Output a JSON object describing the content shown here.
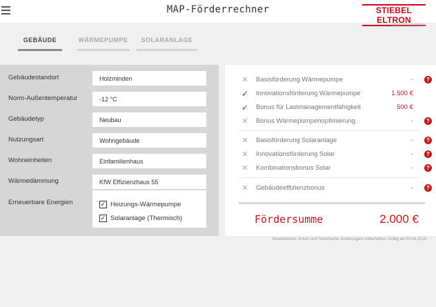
{
  "header": {
    "title": "MAP-Förderrechner",
    "logo_text": "STIEBEL ELTRON",
    "menu_icon": "hamburger-icon",
    "brand_color": "#d0021b"
  },
  "version": "IMT/ITPI.v0.00beta",
  "tabs": [
    {
      "label": "GEBÄUDE",
      "active": true
    },
    {
      "label": "WÄRMEPUMPE",
      "active": false
    },
    {
      "label": "SOLARANLAGE",
      "active": false
    }
  ],
  "form": {
    "fields": [
      {
        "label": "Gebäudestandort",
        "value": "Holzminden"
      },
      {
        "label": "Norm-Außentemperatur",
        "value": "-12 °C"
      },
      {
        "label": "Gebäudetyp",
        "value": "Neubau"
      },
      {
        "label": "Nutzungsart",
        "value": "Wohngebäude"
      },
      {
        "label": "Wohneinheiten",
        "value": "Einfamilienhaus"
      },
      {
        "label": "Wärmedämmung",
        "value": "KfW Effizienzhaus 55"
      }
    ],
    "energy_label": "Erneuerbare Energien",
    "checkboxes": [
      {
        "label": "Heizungs-Wärmepumpe",
        "checked": true
      },
      {
        "label": "Solaranlage (Thermisch)",
        "checked": true
      }
    ]
  },
  "funding": {
    "items": [
      {
        "label": "Basisförderung Wärmepumpe",
        "value": "-",
        "status": "x",
        "help": true
      },
      {
        "label": "Innovationsförderung Wärmepumpe",
        "value": "1.500 €",
        "status": "check",
        "help": false
      },
      {
        "label": "Bonus für Lastmanagementfähigkeit",
        "value": "500 €",
        "status": "check",
        "help": false
      },
      {
        "label": "Bonus Wärmepumpenoptimierung",
        "value": "-",
        "status": "x",
        "help": true
      },
      {
        "label": "Basisförderung Solaranlage",
        "value": "-",
        "status": "x",
        "help": true
      },
      {
        "label": "Innovationsförderung Solar",
        "value": "-",
        "status": "x",
        "help": true
      },
      {
        "label": "Kombinationsbonus Solar",
        "value": "-",
        "status": "x",
        "help": true
      },
      {
        "label": "Gebäudeeffizienzbonus",
        "value": "-",
        "status": "x",
        "help": true
      }
    ],
    "sum_label": "Fördersumme",
    "sum_value": "2.000 €",
    "help_symbol": "?",
    "accent_color": "#c4151c"
  },
  "footer_note": "Vorabversion. Irrtum und Technische Änderungen vorbehalten. Gültig ab 01.04.2015"
}
